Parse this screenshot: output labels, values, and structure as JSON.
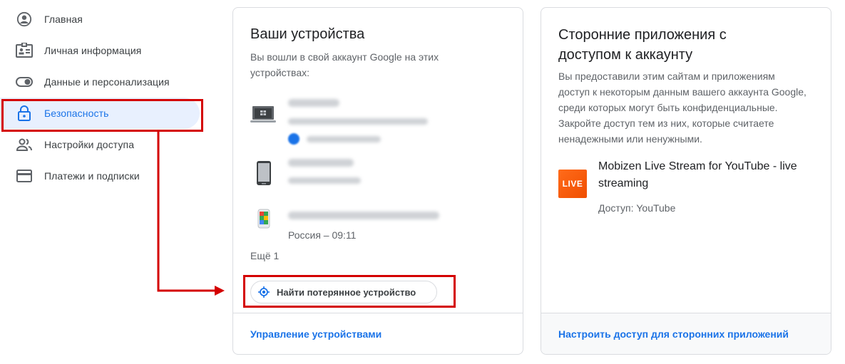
{
  "sidebar": {
    "items": [
      {
        "label": "Главная",
        "icon": "account-circle-icon"
      },
      {
        "label": "Личная информация",
        "icon": "id-card-icon"
      },
      {
        "label": "Данные и персонализация",
        "icon": "toggle-icon"
      },
      {
        "label": "Безопасность",
        "icon": "lock-icon",
        "active": true
      },
      {
        "label": "Настройки доступа",
        "icon": "people-icon"
      },
      {
        "label": "Платежи и подписки",
        "icon": "credit-card-icon"
      }
    ]
  },
  "devices_card": {
    "title": "Ваши устройства",
    "description": "Вы вошли в свой аккаунт Google на этих устройствах:",
    "devices": [
      {
        "icon": "laptop-icon",
        "name": "",
        "location": "",
        "status": ""
      },
      {
        "icon": "phone-icon",
        "name": "",
        "location": ""
      },
      {
        "icon": "phone-color-icon",
        "name": "",
        "location": "Россия – 09:11"
      }
    ],
    "more": "Ещё 1",
    "find_button": "Найти потерянное устройство",
    "footer_link": "Управление устройствами"
  },
  "apps_card": {
    "title": "Сторонние приложения с доступом к аккаунту",
    "description": "Вы предоставили этим сайтам и приложениям доступ к некоторым данным вашего аккаунта Google, среди которых могут быть конфиденциальные. Закройте доступ тем из них, которые считаете ненадежными или ненужными.",
    "app": {
      "logo_text": "LIVE",
      "name": "Mobizen Live Stream for YouTube - live streaming",
      "access": "Доступ: YouTube"
    },
    "footer_link": "Настроить доступ для сторонних приложений"
  },
  "colors": {
    "accent": "#1a73e8",
    "highlight": "#d40000",
    "active_bg": "#e8f0fe"
  }
}
